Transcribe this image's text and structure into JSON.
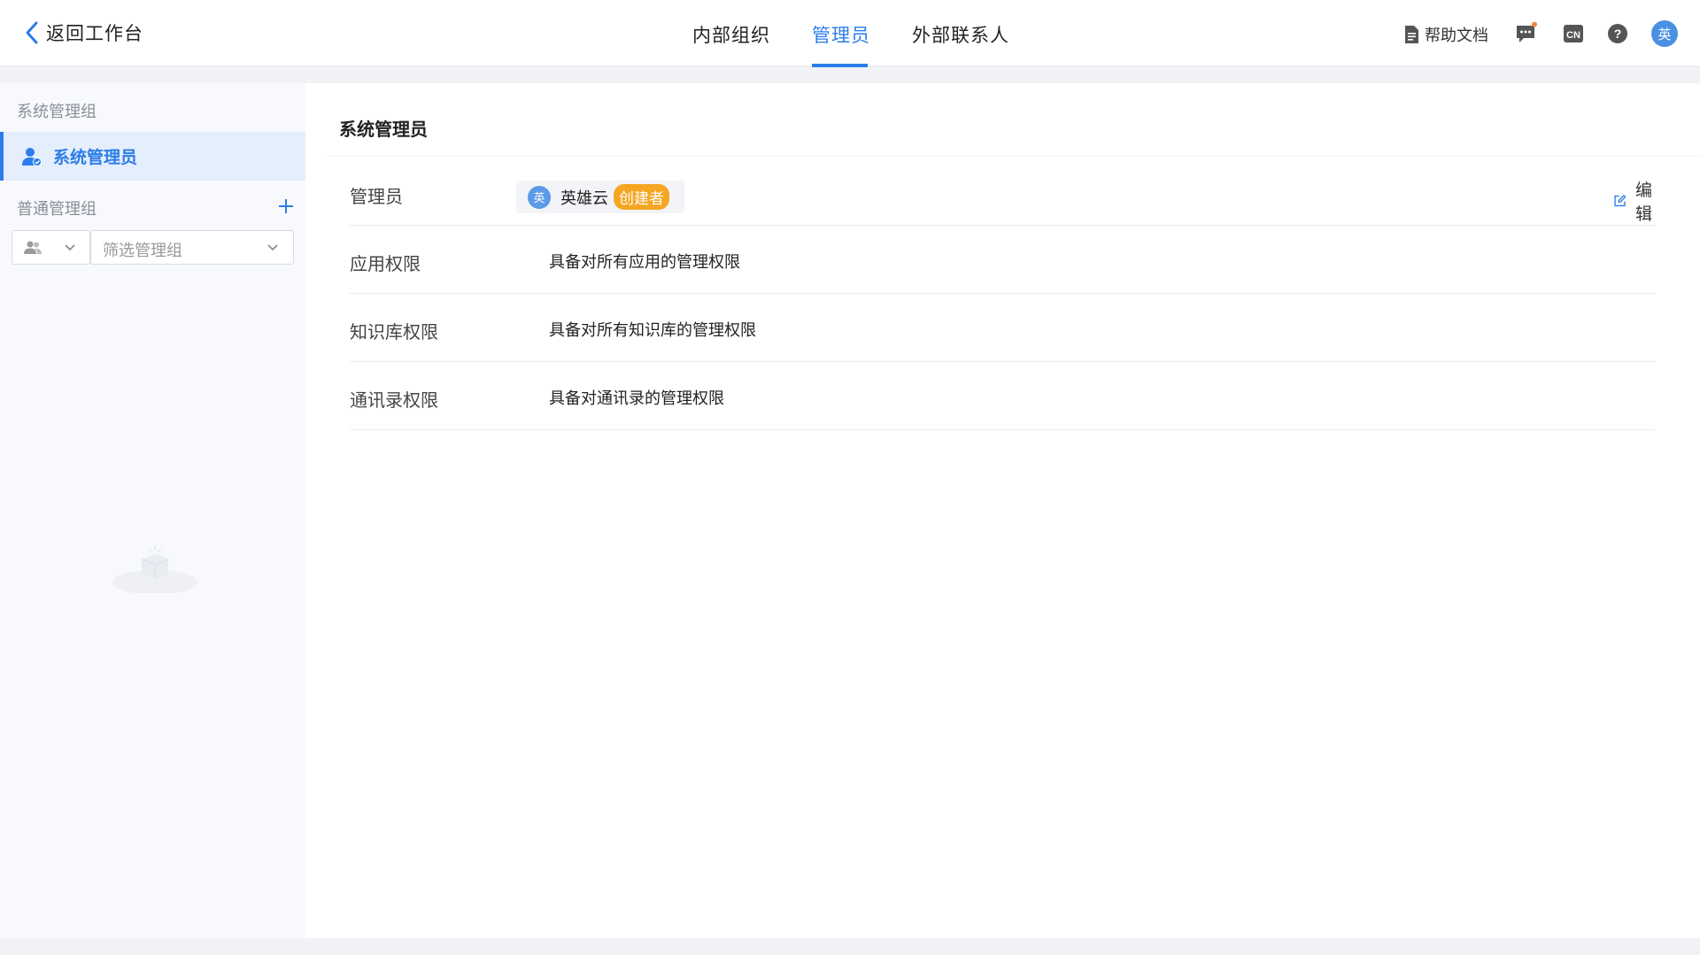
{
  "header": {
    "back_label": "返回工作台",
    "tabs": [
      {
        "label": "内部组织",
        "active": false
      },
      {
        "label": "管理员",
        "active": true
      },
      {
        "label": "外部联系人",
        "active": false
      }
    ],
    "help_doc_label": "帮助文档",
    "avatar_text": "英",
    "accent_color": "#2b7de9",
    "notification_dot_color": "#f0883e"
  },
  "sidebar": {
    "system_group_title": "系统管理组",
    "system_item_label": "系统管理员",
    "normal_group_title": "普通管理组",
    "filter_placeholder": "筛选管理组"
  },
  "main": {
    "title": "系统管理员",
    "edit_label": "编辑",
    "admin_row": {
      "label": "管理员",
      "avatar_text": "英",
      "name": "英雄云",
      "badge": "创建者",
      "badge_color": "#f5a623"
    },
    "permissions": [
      {
        "label": "应用权限",
        "value": "具备对所有应用的管理权限"
      },
      {
        "label": "知识库权限",
        "value": "具备对所有知识库的管理权限"
      },
      {
        "label": "通讯录权限",
        "value": "具备对通讯录的管理权限"
      }
    ]
  }
}
